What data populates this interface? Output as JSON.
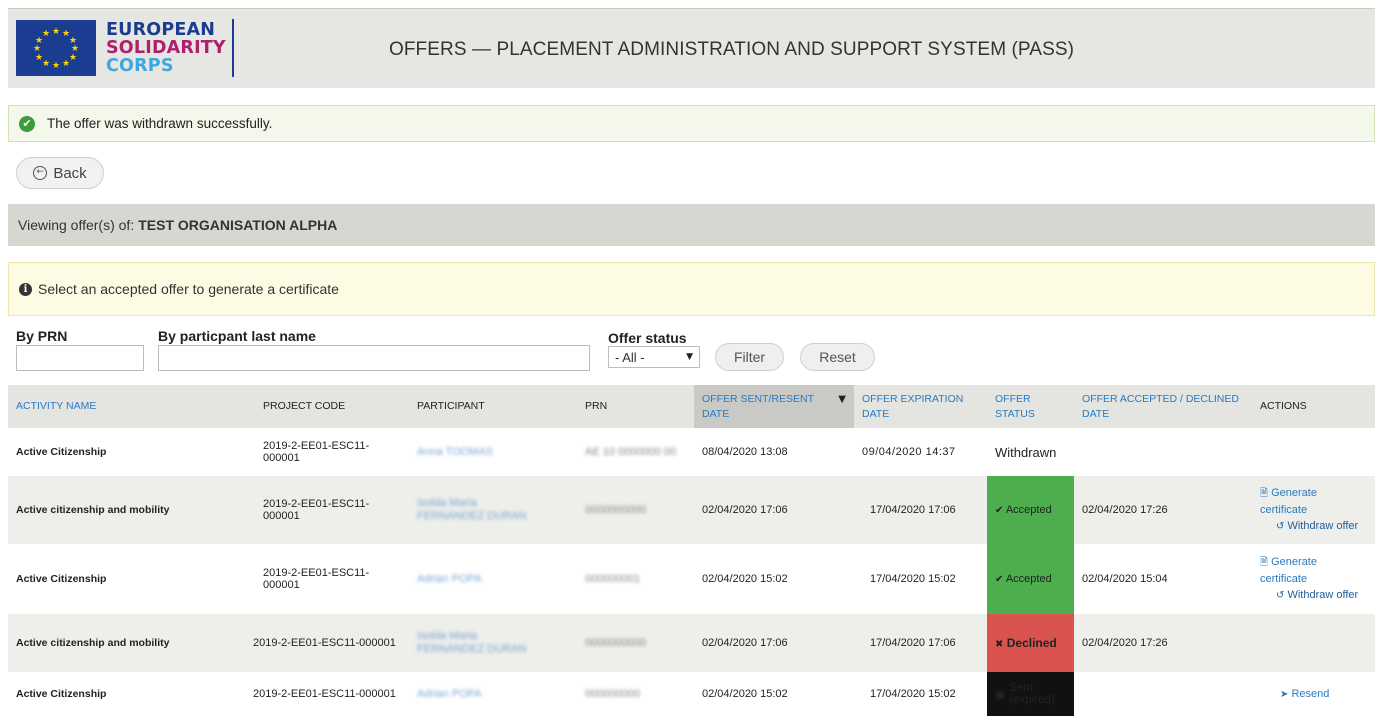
{
  "header": {
    "logo_line1": "EUROPEAN",
    "logo_line2": "SOLIDARITY",
    "logo_line3": "CORPS",
    "title": "OFFERS — PLACEMENT ADMINISTRATION AND SUPPORT SYSTEM (PASS)"
  },
  "success_message": "The offer was withdrawn successfully.",
  "back_label": "Back",
  "viewing": {
    "prefix": "Viewing offer(s) of:",
    "organisation": "TEST ORGANISATION ALPHA"
  },
  "info_message": "Select an accepted offer to generate a certificate",
  "filters": {
    "prn_label": "By PRN",
    "prn_value": "",
    "lastname_label": "By particpant last name",
    "lastname_value": "",
    "status_label": "Offer status",
    "status_selected": "- All -",
    "filter_button": "Filter",
    "reset_button": "Reset"
  },
  "table": {
    "columns": {
      "activity": "ACTIVITY NAME",
      "project": "PROJECT CODE",
      "participant": "PARTICIPANT",
      "prn": "PRN",
      "sent": "OFFER SENT/RESENT DATE",
      "expiration": "OFFER EXPIRATION DATE",
      "status": "OFFER STATUS",
      "accepted": "OFFER ACCEPTED / DECLINED DATE",
      "actions": "ACTIONS"
    },
    "rows": [
      {
        "activity": "Active Citizenship",
        "project": "2019-2-EE01-ESC11-000001",
        "participant": "Anna TOOMAS",
        "prn": "AE 10 0000000 00",
        "sent": "08/04/2020 13:08",
        "expiration": "09/04/2020 14:37",
        "status": "Withdrawn",
        "accepted": ""
      },
      {
        "activity": "Active citizenship and mobility",
        "project": "2019-2-EE01-ESC11-000001",
        "participant": "Isolda Maria FERNANDEZ DURAN",
        "prn": "0000000000",
        "sent": "02/04/2020 17:06",
        "expiration": "17/04/2020 17:06",
        "status": "Accepted",
        "accepted": "02/04/2020 17:26",
        "action_generate": "Generate certificate",
        "action_withdraw": "Withdraw offer"
      },
      {
        "activity": "Active Citizenship",
        "project": "2019-2-EE01-ESC11-000001",
        "participant": "Adrian POPA",
        "prn": "000000001",
        "sent": "02/04/2020 15:02",
        "expiration": "17/04/2020 15:02",
        "status": "Accepted",
        "accepted": "02/04/2020 15:04",
        "action_generate": "Generate certificate",
        "action_withdraw": "Withdraw offer"
      },
      {
        "activity": "Active citizenship and mobility",
        "project": "2019-2-EE01-ESC11-000001",
        "participant": "Isolda Maria FERNANDEZ DURAN",
        "prn": "0000000000",
        "sent": "02/04/2020 17:06",
        "expiration": "17/04/2020 17:06",
        "status": "Declined",
        "accepted": "02/04/2020 17:26"
      },
      {
        "activity": "Active Citizenship",
        "project": "2019-2-EE01-ESC11-000001",
        "participant": "Adrian POPA",
        "prn": "000000000",
        "sent": "02/04/2020 15:02",
        "expiration": "17/04/2020 15:02",
        "status_line1": "Sent",
        "status_line2": "(expired)",
        "accepted": "",
        "action_resend": "Resend"
      }
    ]
  },
  "colors": {
    "accepted": "#4cae4c",
    "declined": "#d9534f",
    "expired": "#111111",
    "link": "#2a7ac2"
  }
}
